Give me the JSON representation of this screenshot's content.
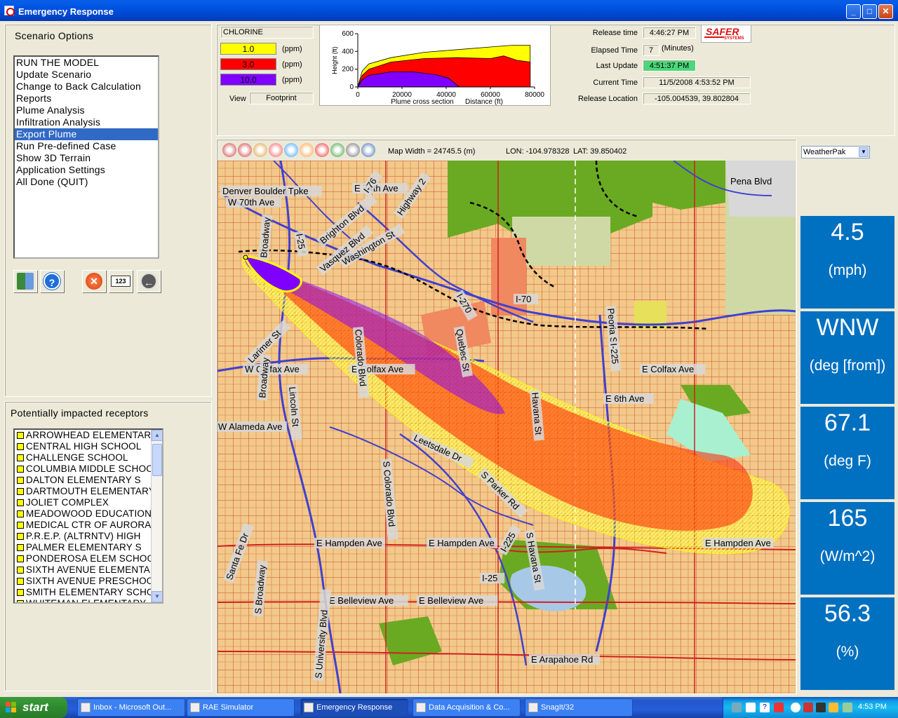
{
  "window": {
    "title": "Emergency Response"
  },
  "scenario": {
    "heading": "Scenario Options",
    "items": [
      "RUN THE MODEL",
      "Update Scenario",
      "Change to Back Calculation",
      "Reports",
      "Plume Analysis",
      "Infiltration Analysis",
      "Export Plume",
      "Run Pre-defined Case",
      "Show 3D Terrain",
      "Application Settings",
      "All Done (QUIT)"
    ],
    "selected_index": 6
  },
  "toolbar_icons": [
    "book-icon",
    "help-icon",
    "stop-icon",
    "calculator-icon",
    "back-arrow-icon"
  ],
  "receptors": {
    "heading": "Potentially impacted receptors",
    "items": [
      "ARROWHEAD ELEMENTARY",
      "CENTRAL HIGH SCHOOL",
      "CHALLENGE SCHOOL",
      "COLUMBIA MIDDLE SCHOOL",
      "DALTON ELEMENTARY S",
      "DARTMOUTH ELEMENTARY",
      "JOLIET COMPLEX",
      "MEADOWOOD EDUCATION",
      "MEDICAL CTR OF AURORA",
      "P.R.E.P. (ALTRNTV) HIGH",
      "PALMER ELEMENTARY S",
      "PONDEROSA ELEM SCHOOL",
      "SIXTH AVENUE ELEMENTARY",
      "SIXTH AVENUE PRESCHOOL",
      "SMITH ELEMENTARY SCHOOL",
      "WHITEMAN ELEMENTARY"
    ]
  },
  "chemical": {
    "name": "CHLORINE",
    "levels": [
      {
        "value": "1.0",
        "unit": "(ppm)",
        "color": "#ffff00"
      },
      {
        "value": "3.0",
        "unit": "(ppm)",
        "color": "#ff0000"
      },
      {
        "value": "10.0",
        "unit": "(ppm)",
        "color": "#8000ff"
      }
    ],
    "view_label": "View",
    "view_value": "Footprint"
  },
  "chart_data": {
    "type": "area",
    "ylabel": "Height (ft)",
    "xlabel_left": "Plume cross section",
    "xlabel_right": "Distance (ft)",
    "xlim": [
      0,
      80000
    ],
    "ylim": [
      0,
      600
    ],
    "x_ticks": [
      "0",
      "20000",
      "40000",
      "60000",
      "80000"
    ],
    "y_ticks": [
      "600",
      "400",
      "200",
      "0"
    ],
    "series": [
      {
        "color": "#ffff00",
        "x": [
          0,
          2000,
          5000,
          15000,
          30000,
          45000,
          60000,
          70000,
          78000
        ],
        "y": [
          0,
          180,
          260,
          330,
          390,
          420,
          450,
          470,
          470
        ]
      },
      {
        "color": "#ff0000",
        "x": [
          0,
          2000,
          5000,
          15000,
          30000,
          45000,
          60000,
          66000,
          72000,
          78000
        ],
        "y": [
          0,
          130,
          200,
          280,
          320,
          330,
          320,
          350,
          300,
          280
        ]
      },
      {
        "color": "#8000ff",
        "x": [
          0,
          2000,
          5000,
          15000,
          25000,
          35000,
          41000,
          46000
        ],
        "y": [
          0,
          80,
          130,
          170,
          170,
          140,
          100,
          0
        ]
      }
    ]
  },
  "release_info": {
    "release_time_label": "Release time",
    "release_time": "4:46:27 PM",
    "elapsed_label": "Elapsed Time",
    "elapsed": "7",
    "elapsed_unit": "(Minutes)",
    "last_update_label": "Last Update",
    "last_update": "4:51:37 PM",
    "current_time_label": "Current Time",
    "current_time": "11/5/2008  4:53:52 PM",
    "location_label": "Release Location",
    "location": "-105.004539, 39.802804"
  },
  "logo": {
    "name": "SAFER",
    "sub": "SYSTEMS"
  },
  "map": {
    "width_text": "Map Width = 24745.5 (m)",
    "lon_text": "LON: -104.978328",
    "lat_text": "LAT: 39.850402",
    "tools": [
      "zoom-in-icon",
      "zoom-out-icon",
      "pan-hand-icon",
      "zoom-extent-icon",
      "info-icon",
      "layers-icon",
      "red-tool-icon",
      "layer-color-icon",
      "select-icon",
      "globe-icon"
    ],
    "streets": [
      "Denver Boulder Tpke",
      "E 74th Ave",
      "W 70th Ave",
      "Highway 2",
      "Pena Blvd",
      "I-76",
      "Broadway",
      "I-25",
      "I-270",
      "I-70",
      "Larimer St",
      "W Colfax Ave",
      "E Colfax Ave",
      "E Colfax Ave",
      "Broadway",
      "Lincoln St",
      "E 6th Ave",
      "W Alameda Ave",
      "Leetsdale Dr",
      "S Parker Rd",
      "S Havana St",
      "S Colorado Blvd",
      "E Hampden Ave",
      "E Hampden Ave",
      "E Hampden Ave",
      "S Broadway",
      "E Belleview Ave",
      "E Belleview Ave",
      "S University Blvd",
      "E Arapahoe Rd",
      "I-225",
      "I-25",
      "Quebec St",
      "Havana St",
      "Peoria St",
      "Santa Fe Dr",
      "Colorado Blvd",
      "Washington St",
      "Brighton Blvd",
      "Vasquez Blvd",
      "I-225"
    ]
  },
  "weather": {
    "source": "WeatherPak",
    "boxes": [
      {
        "value": "4.5",
        "unit": "(mph)"
      },
      {
        "value": "WNW",
        "unit": "(deg [from])"
      },
      {
        "value": "67.1",
        "unit": "(deg F)"
      },
      {
        "value": "165",
        "unit": "(W/m^2)"
      },
      {
        "value": "56.3",
        "unit": "(%)"
      }
    ]
  },
  "taskbar": {
    "start": "start",
    "tasks": [
      {
        "label": "Inbox - Microsoft Out...",
        "active": false
      },
      {
        "label": "RAE Simulator",
        "active": false
      },
      {
        "label": "Emergency Response",
        "active": true
      },
      {
        "label": "Data Acquisition & Co...",
        "active": false
      },
      {
        "label": "SnagIt/32",
        "active": false
      }
    ],
    "clock": "4:53 PM"
  }
}
